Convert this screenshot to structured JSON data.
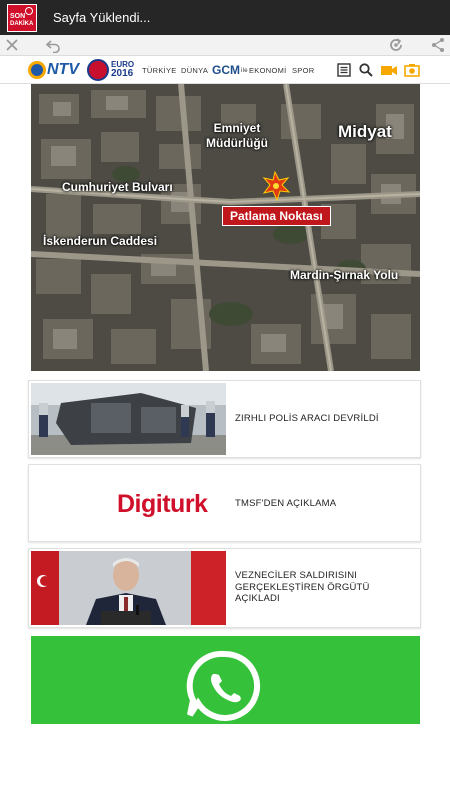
{
  "app": {
    "logo_line1": "SON",
    "logo_line2": "DAKİKA",
    "window_title": "Sayfa Yüklendi..."
  },
  "browser": {
    "icons": [
      "close-icon",
      "back-icon",
      "refresh-icon",
      "share-icon"
    ]
  },
  "site_nav": {
    "brand": "NTV",
    "euro_line1": "EURO",
    "euro_line2": "2016",
    "links": [
      "TÜRKİYE",
      "DÜNYA",
      "GCM",
      "EKONOMİ",
      "SPOR"
    ],
    "gcm_label": "GCM",
    "gcm_suffix": "ile",
    "icons": [
      "menu-icon",
      "search-icon",
      "video-icon",
      "camera-icon"
    ],
    "accent": "#f6a800"
  },
  "hero": {
    "labels": {
      "emniyet_line1": "Emniyet",
      "emniyet_line2": "Müdürlüğü",
      "midyat": "Midyat",
      "cumhuriyet": "Cumhuriyet Bulvarı",
      "patlama": "Patlama Noktası",
      "iskenderun": "İskenderun Caddesi",
      "mardin": "Mardin-Şırnak Yolu"
    }
  },
  "articles": [
    {
      "headline": "ZIRHLI POLİS ARACI DEVRİLDİ"
    },
    {
      "headline": "TMSF'DEN AÇIKLAMA",
      "sponsor_logo": "Digiturk"
    },
    {
      "headline": "VEZNECİLER SALDIRISINI GERÇEKLEŞTİREN ÖRGÜTÜ AÇIKLADI"
    }
  ],
  "promo": {
    "icon": "whatsapp-icon",
    "color": "#36c13b"
  }
}
